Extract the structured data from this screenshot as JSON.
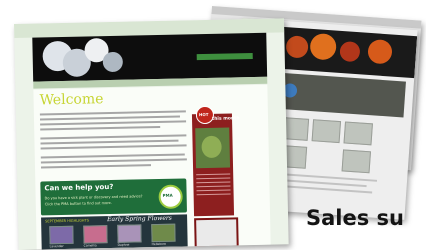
{
  "main_page": {
    "heading": "Welcome",
    "help_box": {
      "title": "Can we help you?",
      "line1": "Do you have a sick plant or discovery and need advice?",
      "line2": "Click the PMA button to find out more.",
      "badge": "PMA"
    },
    "highlights": {
      "label": "SEPTEMBER HIGHLIGHTS",
      "title": "Early Spring Flowers",
      "captions": [
        "Lavender",
        "Camellia",
        "Daphne",
        "Hellebore"
      ]
    },
    "hot_panel": {
      "badge": "HOT",
      "title": "this month"
    }
  },
  "caption": {
    "text": "Sales su"
  },
  "colors": {
    "accent_green": "#1f6e3a",
    "welcome_yellow": "#c7d534",
    "hot_red": "#8d1f1f"
  }
}
